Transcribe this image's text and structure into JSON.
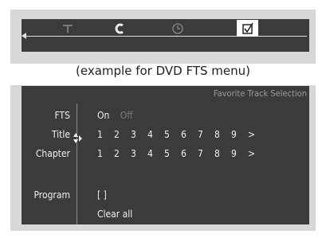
{
  "caption": "(example for DVD FTS menu)",
  "tabs": {
    "title_icon": "title-icon",
    "chapter_icon": "chapter-icon",
    "time_icon": "clock-icon",
    "fts_icon": "checkbox-icon"
  },
  "fts_menu": {
    "header": "Favorite Track Selection",
    "fts_label": "FTS",
    "on": "On",
    "off": "Off",
    "title_label": "Title",
    "chapter_label": "Chapter",
    "program_label": "Program",
    "title_numbers": [
      "1",
      "2",
      "3",
      "4",
      "5",
      "6",
      "7",
      "8",
      "9",
      ">"
    ],
    "chapter_numbers": [
      "1",
      "2",
      "3",
      "4",
      "5",
      "6",
      "7",
      "8",
      "9",
      ">"
    ],
    "program_value": "[ ]",
    "clear_all": "Clear all"
  }
}
